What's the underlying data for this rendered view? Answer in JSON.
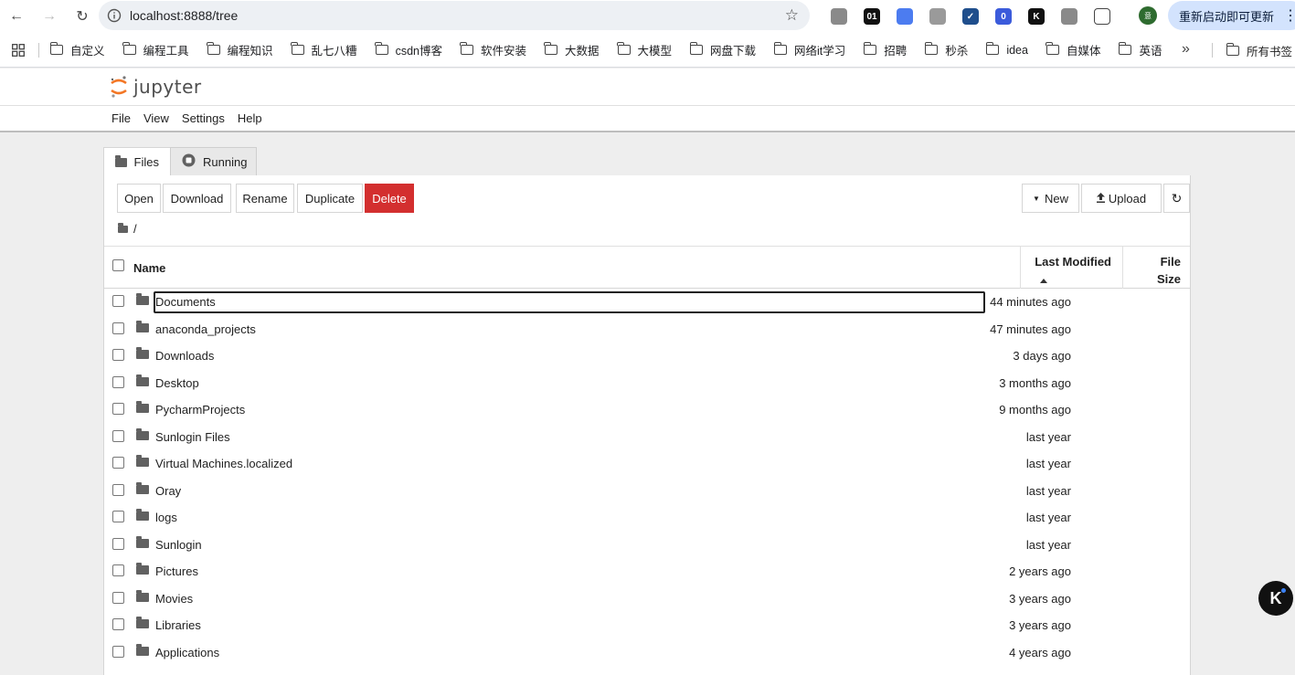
{
  "browser": {
    "url": "localhost:8888/tree",
    "update_label": "重新启动即可更新",
    "profile_initial": "意",
    "extensions": [
      {
        "name": "vue-devtools-icon",
        "color": "#8a8a8a",
        "label": ""
      },
      {
        "name": "01-extension-icon",
        "color": "#111111",
        "label": "01"
      },
      {
        "name": "translate-extension-icon",
        "color": "#4c7cf0",
        "label": ""
      },
      {
        "name": "shield-extension-icon",
        "color": "#9a9a9a",
        "label": ""
      },
      {
        "name": "check-extension-icon",
        "color": "#1f4e8c",
        "label": "✓"
      },
      {
        "name": "badge-extension-icon",
        "color": "#3b5bdb",
        "label": "0"
      },
      {
        "name": "k-extension-icon",
        "color": "#111111",
        "label": "K"
      },
      {
        "name": "store-extension-icon",
        "color": "#8a8a8a",
        "label": ""
      },
      {
        "name": "puzzle-extension-icon",
        "color": "#ffffff",
        "label": ""
      }
    ],
    "bookmarks": [
      "自定义",
      "编程工具",
      "编程知识",
      "乱七八糟",
      "csdn博客",
      "软件安装",
      "大数据",
      "大模型",
      "网盘下载",
      "网络it学习",
      "招聘",
      "秒杀",
      "idea",
      "自媒体",
      "英语"
    ],
    "all_bookmarks_label": "所有书签"
  },
  "jupyter": {
    "logo_text": "jupyter",
    "menu": [
      "File",
      "View",
      "Settings",
      "Help"
    ],
    "tabs": {
      "files": "Files",
      "running": "Running"
    },
    "toolbar": {
      "open": "Open",
      "download": "Download",
      "rename": "Rename",
      "duplicate": "Duplicate",
      "delete": "Delete",
      "new": "New",
      "upload": "Upload"
    },
    "breadcrumb": "/",
    "columns": {
      "name": "Name",
      "last_modified": "Last Modified",
      "file_size_line1": "File",
      "file_size_line2": "Size"
    },
    "files": [
      {
        "name": "Documents",
        "modified": "44 minutes ago"
      },
      {
        "name": "anaconda_projects",
        "modified": "47 minutes ago"
      },
      {
        "name": "Downloads",
        "modified": "3 days ago"
      },
      {
        "name": "Desktop",
        "modified": "3 months ago"
      },
      {
        "name": "PycharmProjects",
        "modified": "9 months ago"
      },
      {
        "name": "Sunlogin Files",
        "modified": "last year"
      },
      {
        "name": "Virtual Machines.localized",
        "modified": "last year"
      },
      {
        "name": "Oray",
        "modified": "last year"
      },
      {
        "name": "logs",
        "modified": "last year"
      },
      {
        "name": "Sunlogin",
        "modified": "last year"
      },
      {
        "name": "Pictures",
        "modified": "2 years ago"
      },
      {
        "name": "Movies",
        "modified": "3 years ago"
      },
      {
        "name": "Libraries",
        "modified": "3 years ago"
      },
      {
        "name": "Applications",
        "modified": "4 years ago"
      }
    ]
  },
  "colors": {
    "delete_button": "#d32f2f",
    "jupyter_orange": "#f37726",
    "update_pill": "#d3e3fd"
  }
}
